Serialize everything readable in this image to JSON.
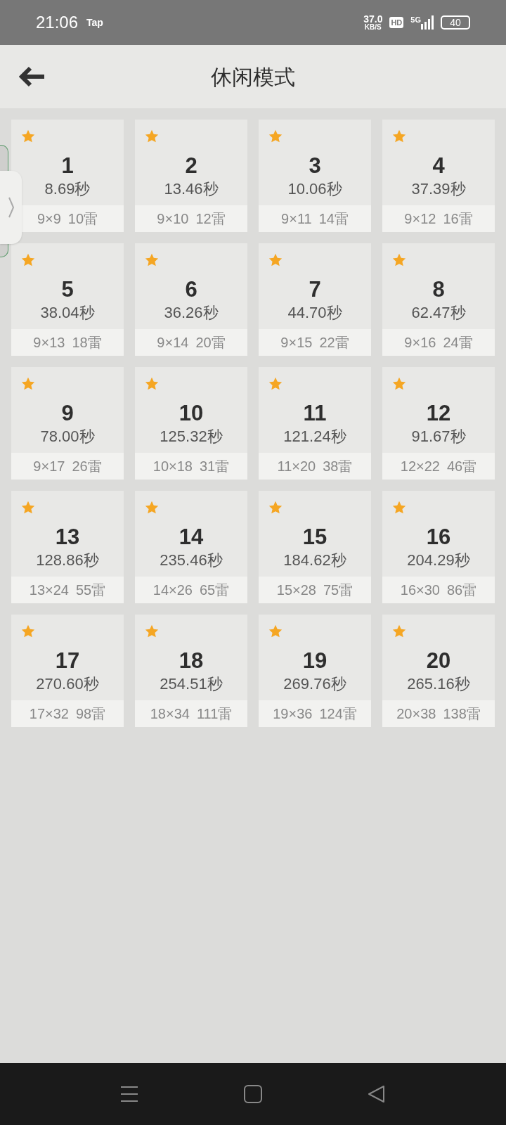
{
  "status_bar": {
    "time": "21:06",
    "app": "Tap",
    "speed": "37.0",
    "speed_unit": "KB/S",
    "hd": "HD",
    "network": "5G",
    "battery": "40"
  },
  "header": {
    "title": "休闲模式"
  },
  "levels": [
    {
      "number": "1",
      "time": "8.69秒",
      "size": "9×9",
      "mines": "10雷",
      "completed": true
    },
    {
      "number": "2",
      "time": "13.46秒",
      "size": "9×10",
      "mines": "12雷",
      "completed": true
    },
    {
      "number": "3",
      "time": "10.06秒",
      "size": "9×11",
      "mines": "14雷",
      "completed": true
    },
    {
      "number": "4",
      "time": "37.39秒",
      "size": "9×12",
      "mines": "16雷",
      "completed": true
    },
    {
      "number": "5",
      "time": "38.04秒",
      "size": "9×13",
      "mines": "18雷",
      "completed": true
    },
    {
      "number": "6",
      "time": "36.26秒",
      "size": "9×14",
      "mines": "20雷",
      "completed": true
    },
    {
      "number": "7",
      "time": "44.70秒",
      "size": "9×15",
      "mines": "22雷",
      "completed": true
    },
    {
      "number": "8",
      "time": "62.47秒",
      "size": "9×16",
      "mines": "24雷",
      "completed": true
    },
    {
      "number": "9",
      "time": "78.00秒",
      "size": "9×17",
      "mines": "26雷",
      "completed": true
    },
    {
      "number": "10",
      "time": "125.32秒",
      "size": "10×18",
      "mines": "31雷",
      "completed": true
    },
    {
      "number": "11",
      "time": "121.24秒",
      "size": "11×20",
      "mines": "38雷",
      "completed": true
    },
    {
      "number": "12",
      "time": "91.67秒",
      "size": "12×22",
      "mines": "46雷",
      "completed": true
    },
    {
      "number": "13",
      "time": "128.86秒",
      "size": "13×24",
      "mines": "55雷",
      "completed": true
    },
    {
      "number": "14",
      "time": "235.46秒",
      "size": "14×26",
      "mines": "65雷",
      "completed": true
    },
    {
      "number": "15",
      "time": "184.62秒",
      "size": "15×28",
      "mines": "75雷",
      "completed": true
    },
    {
      "number": "16",
      "time": "204.29秒",
      "size": "16×30",
      "mines": "86雷",
      "completed": true
    },
    {
      "number": "17",
      "time": "270.60秒",
      "size": "17×32",
      "mines": "98雷",
      "completed": true
    },
    {
      "number": "18",
      "time": "254.51秒",
      "size": "18×34",
      "mines": "111雷",
      "completed": true
    },
    {
      "number": "19",
      "time": "269.76秒",
      "size": "19×36",
      "mines": "124雷",
      "completed": true
    },
    {
      "number": "20",
      "time": "265.16秒",
      "size": "20×38",
      "mines": "138雷",
      "completed": true
    }
  ]
}
